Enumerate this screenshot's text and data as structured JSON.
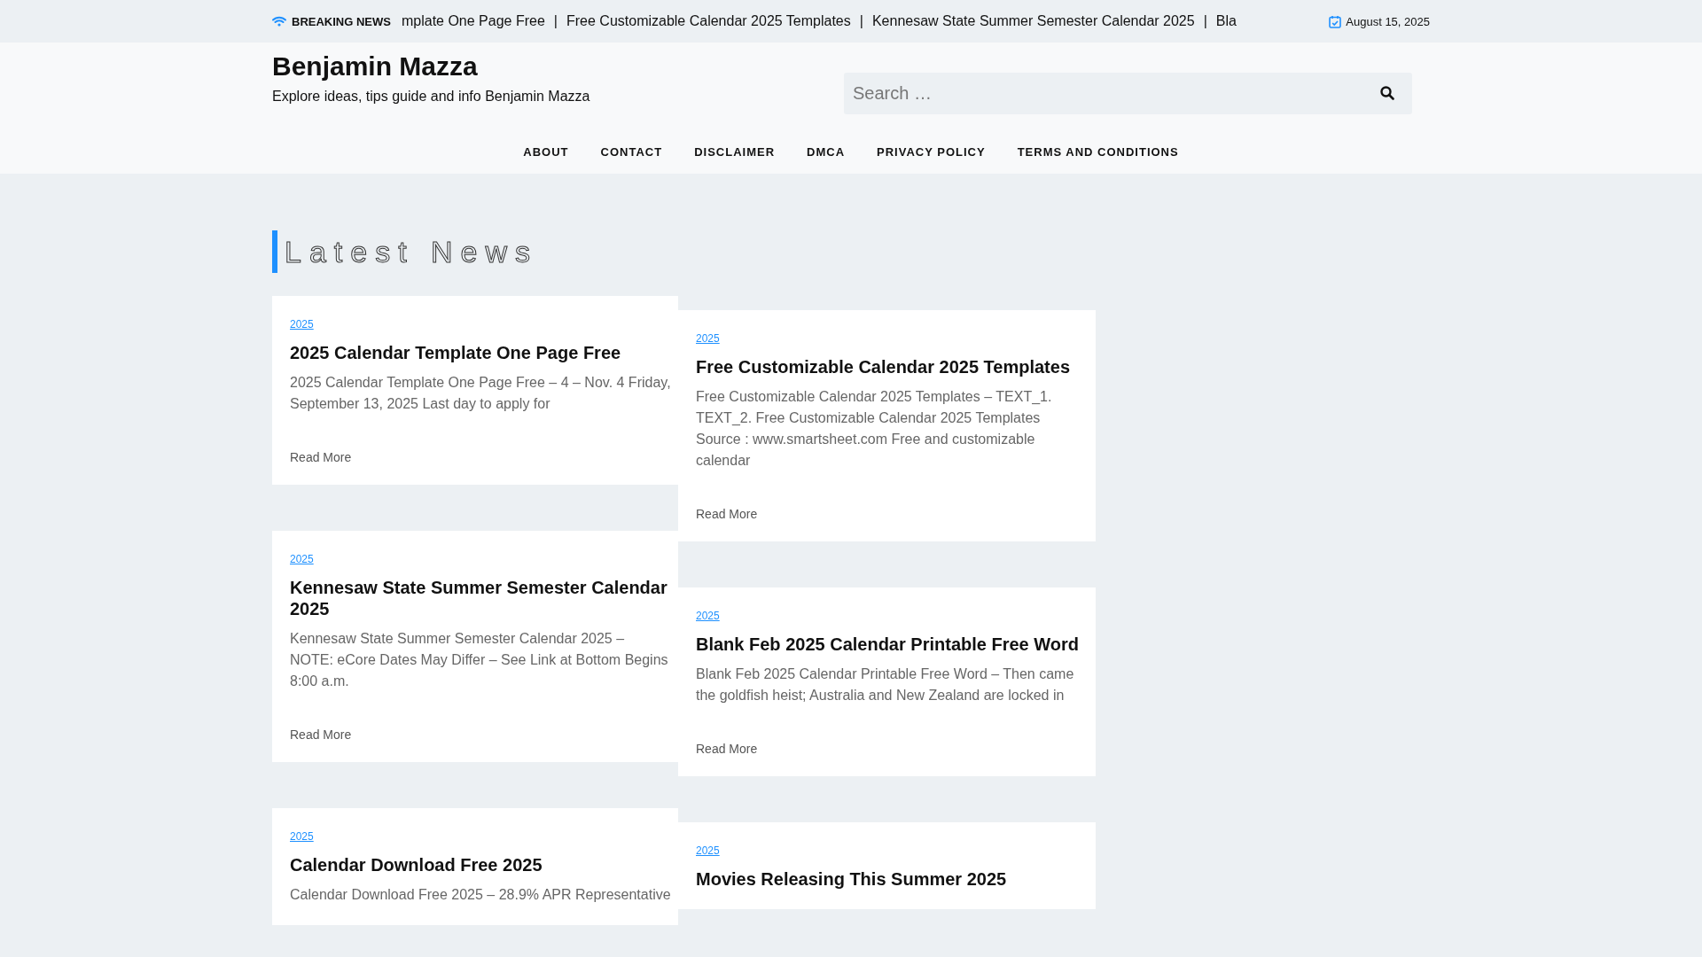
{
  "top_bar": {
    "label": "BREAKING NEWS",
    "separator": "|",
    "ticker": [
      "mplate One Page Free",
      "Free Customizable Calendar 2025 Templates",
      "Kennesaw State Summer Semester Calendar 2025",
      "Bla"
    ],
    "date": "August 15, 2025"
  },
  "header": {
    "site_title": "Benjamin Mazza",
    "tagline": "Explore ideas, tips guide and info Benjamin Mazza",
    "search": {
      "placeholder": "Search …"
    }
  },
  "nav": [
    "ABOUT",
    "CONTACT",
    "DISCLAIMER",
    "DMCA",
    "PRIVACY POLICY",
    "TERMS AND CONDITIONS"
  ],
  "section_title": "Latest News",
  "columns": [
    [
      {
        "category": "2025",
        "title": "2025 Calendar Template One Page Free",
        "excerpt": "2025 Calendar Template One Page Free – 4 – Nov. 4 Friday, September 13, 2025 Last day to apply for",
        "read_more": "Read More"
      },
      {
        "category": "2025",
        "title": "Kennesaw State Summer Semester Calendar 2025",
        "excerpt": "Kennesaw State Summer Semester Calendar 2025 – NOTE: eCore Dates May Differ – See Link at Bottom Begins 8:00 a.m.",
        "read_more": "Read More"
      },
      {
        "category": "2025",
        "title": "Calendar Download Free 2025",
        "excerpt": "Calendar Download Free 2025 – 28.9% APR Representative"
      }
    ],
    [
      {
        "category": "2025",
        "title": "Free Customizable Calendar 2025 Templates",
        "excerpt": "Free Customizable Calendar 2025 Templates – TEXT_1. TEXT_2. Free Customizable Calendar 2025 Templates Source : www.smartsheet.com Free and customizable calendar",
        "read_more": "Read More"
      },
      {
        "category": "2025",
        "title": "Blank Feb 2025 Calendar Printable Free Word",
        "excerpt": "Blank Feb 2025 Calendar Printable Free Word – Then came the goldfish heist; Australia and New Zealand are locked in",
        "read_more": "Read More"
      },
      {
        "category": "2025",
        "title": "Movies Releasing This Summer 2025"
      }
    ]
  ]
}
